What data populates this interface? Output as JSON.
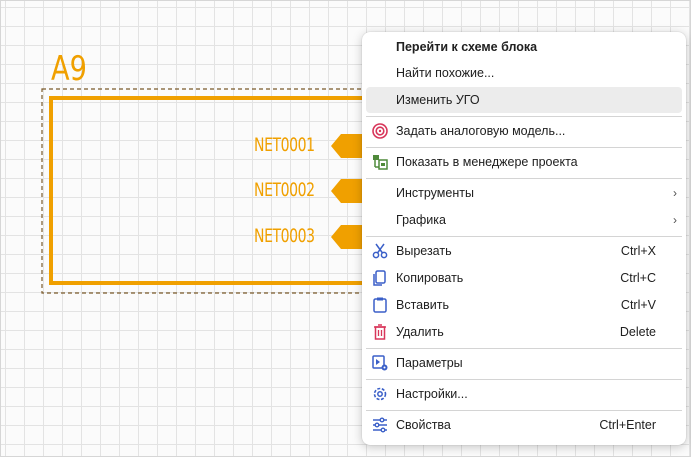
{
  "schematic": {
    "ref_designator": "A9",
    "nets": [
      "NET0001",
      "NET0002",
      "NET0003"
    ],
    "accent_color": "#f0a000"
  },
  "context_menu": {
    "go_to_block": "Перейти к схеме блока",
    "find_similar": "Найти похожие...",
    "edit_symbol": "Изменить УГО",
    "set_analog_model": "Задать аналоговую модель...",
    "show_in_project_manager": "Показать в менеджере проекта",
    "tools": "Инструменты",
    "graphics": "Графика",
    "cut": {
      "label": "Вырезать",
      "shortcut": "Ctrl+X"
    },
    "copy": {
      "label": "Копировать",
      "shortcut": "Ctrl+C"
    },
    "paste": {
      "label": "Вставить",
      "shortcut": "Ctrl+V"
    },
    "delete": {
      "label": "Удалить",
      "shortcut": "Delete"
    },
    "parameters": "Параметры",
    "settings": "Настройки...",
    "properties": {
      "label": "Свойства",
      "shortcut": "Ctrl+Enter"
    },
    "submenu_arrow": "›",
    "highlighted_item": "edit_symbol"
  }
}
